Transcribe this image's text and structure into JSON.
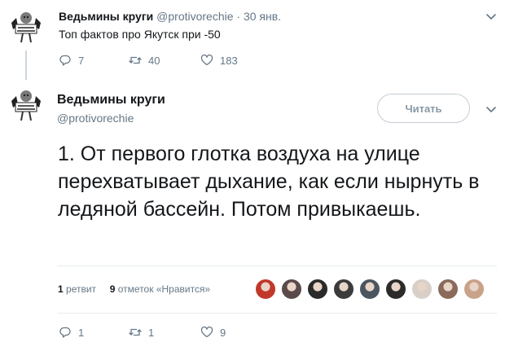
{
  "tweet1": {
    "name": "Ведьмины круги",
    "handle": "@protivorechie",
    "date": "· 30 янв.",
    "text": "Топ фактов про Якутск при -50",
    "replies": "7",
    "retweets": "40",
    "likes": "183"
  },
  "tweet2": {
    "name": "Ведьмины круги",
    "handle": "@protivorechie",
    "follow_label": "Читать",
    "text": "1. От первого глотка воздуха на улице перехватывает дыхание, как если нырнуть в ледяной бассейн. Потом привыкаешь.",
    "retweet_count": "1",
    "retweet_label": "ретвит",
    "like_count": "9",
    "like_label": "отметок «Нравится»",
    "replies": "1",
    "retweets": "1",
    "likes": "9",
    "liker_colors": [
      "#c0392b",
      "#5a4a4a",
      "#2a2a2a",
      "#3b3b3b",
      "#4a5560",
      "#2b2b2b",
      "#d8d0c8",
      "#8a6a5a",
      "#c9a28a"
    ]
  },
  "avatar_text": "I HATE EVERYONE",
  "colors": {
    "text": "#14171a",
    "secondary": "#657786",
    "divider": "#e6ecf0"
  }
}
